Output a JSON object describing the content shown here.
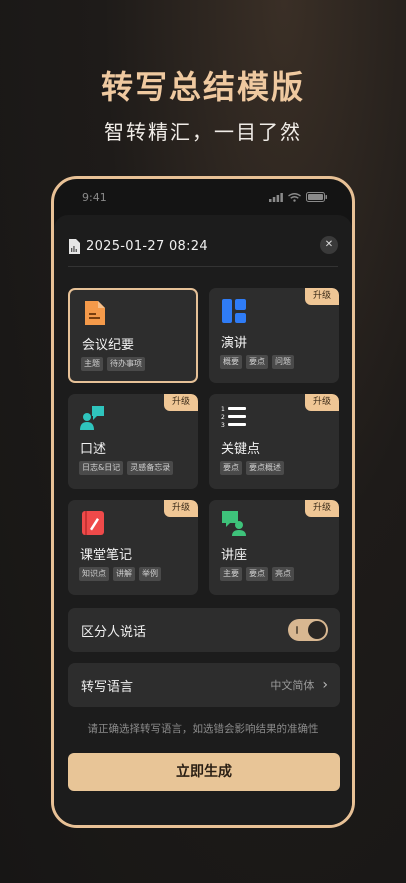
{
  "hero": {
    "title": "转写总结模版",
    "subtitle": "智转精汇，一目了然"
  },
  "status_bar": {
    "time": "9:41"
  },
  "sheet": {
    "datetime": "2025-01-27 08:24",
    "close_icon": "close-icon",
    "templates": [
      {
        "title": "会议纪要",
        "tags": [
          "主题",
          "待办事项"
        ],
        "upgrade": "",
        "selected": true,
        "icon": "meeting-notes-icon",
        "color": "#f59a4a"
      },
      {
        "title": "演讲",
        "tags": [
          "概要",
          "要点",
          "问题"
        ],
        "upgrade": "升级",
        "selected": false,
        "icon": "speech-icon",
        "color": "#2f7cf6"
      },
      {
        "title": "口述",
        "tags": [
          "日志&日记",
          "灵感备忘录"
        ],
        "upgrade": "升级",
        "selected": false,
        "icon": "dictation-icon",
        "color": "#2fc4bd"
      },
      {
        "title": "关键点",
        "tags": [
          "要点",
          "要点概述"
        ],
        "upgrade": "升级",
        "selected": false,
        "icon": "key-points-icon",
        "color": "#ffffff"
      },
      {
        "title": "课堂笔记",
        "tags": [
          "知识点",
          "讲解",
          "举例"
        ],
        "upgrade": "升级",
        "selected": false,
        "icon": "class-notes-icon",
        "color": "#ef4a4a"
      },
      {
        "title": "讲座",
        "tags": [
          "主要",
          "要点",
          "亮点"
        ],
        "upgrade": "升级",
        "selected": false,
        "icon": "lecture-icon",
        "color": "#3ec27a"
      }
    ],
    "speaker_toggle": {
      "label": "区分人说话",
      "on": true
    },
    "language": {
      "label": "转写语言",
      "value": "中文简体"
    },
    "hint": "请正确选择转写语言，如选错会影响结果的准确性",
    "generate_button": "立即生成"
  },
  "colors": {
    "accent": "#e8c597",
    "background": "#1c1c1c",
    "card": "#2d2d2d"
  }
}
